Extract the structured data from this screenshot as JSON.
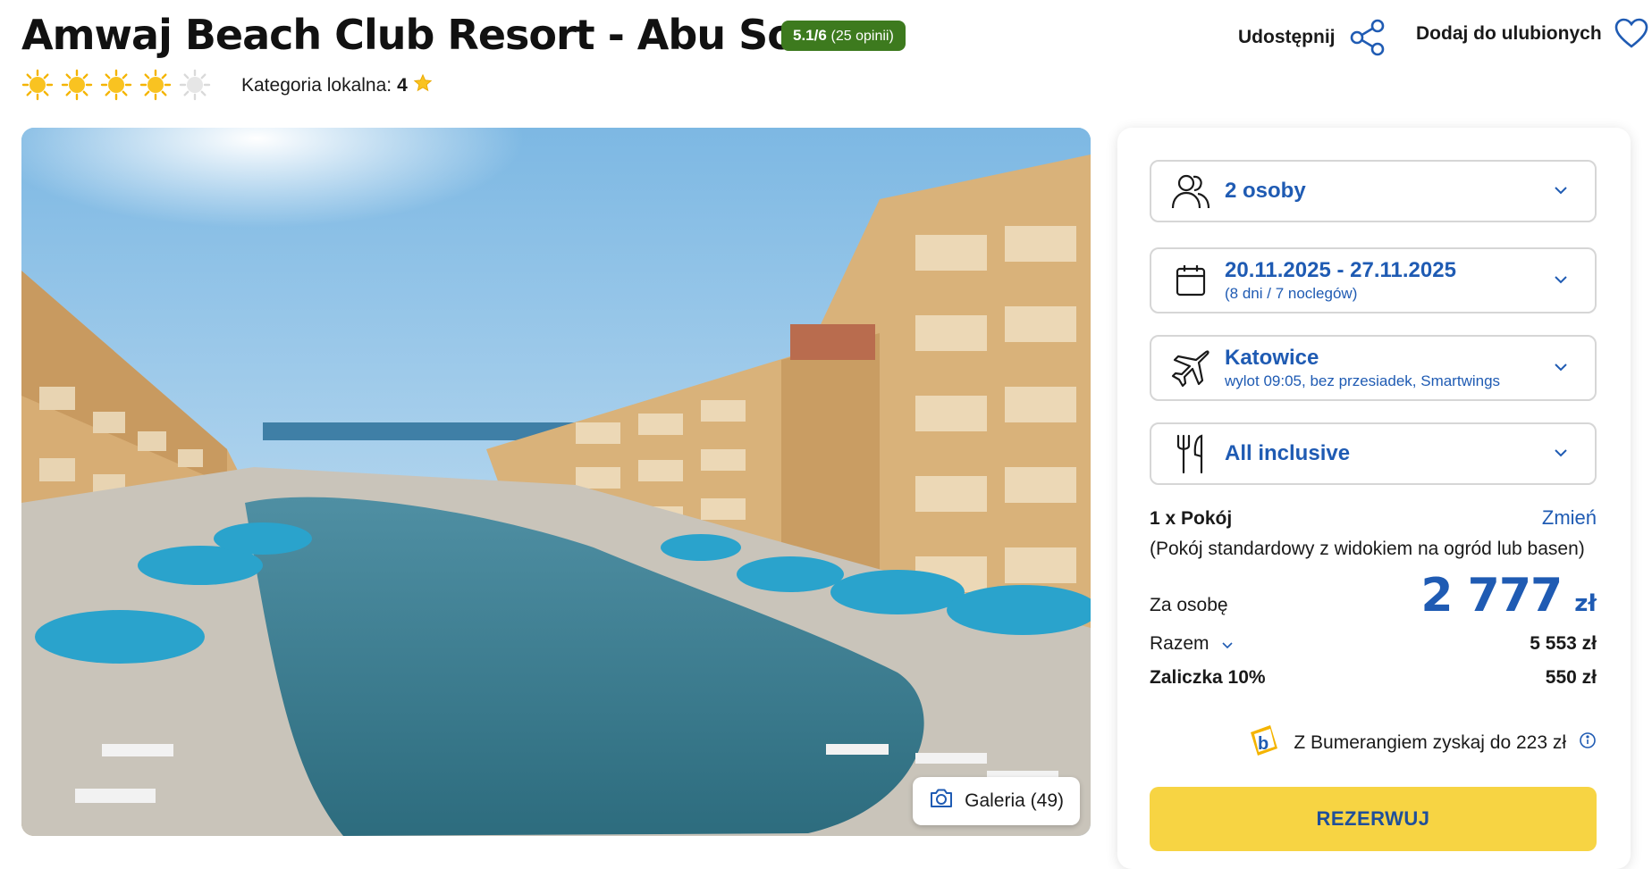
{
  "hotel": {
    "name": "Amwaj Beach Club Resort - Abu Soma",
    "rating_score": "5.1/6",
    "rating_opinions": "(25 opinii)",
    "stars_filled": 4,
    "stars_total": 5,
    "local_category_label": "Kategoria lokalna:",
    "local_category_value": "4"
  },
  "header_actions": {
    "share_label": "Udostępnij",
    "favorite_label": "Dodaj do ulubionych"
  },
  "gallery": {
    "button_label": "Galeria (49)"
  },
  "booking": {
    "guests": "2 osoby",
    "dates": "20.11.2025 - 27.11.2025",
    "dates_sub": "(8 dni / 7 noclegów)",
    "departure_city": "Katowice",
    "flight_info": "wylot 09:05, bez przesiadek, Smartwings",
    "board": "All inclusive",
    "room_count_label": "1 x Pokój",
    "change_link": "Zmień",
    "room_description": "(Pokój standardowy z widokiem na ogród lub basen)",
    "per_person_label": "Za osobę",
    "per_person_price": "2 777",
    "currency": "zł",
    "total_label": "Razem",
    "total_value": "5 553 zł",
    "deposit_label": "Zaliczka 10%",
    "deposit_value": "550 zł",
    "bumerang_text": "Z Bumerangiem zyskaj do 223 zł",
    "reserve_button": "REZERWUJ"
  },
  "colors": {
    "accent_blue": "#1f5bb3",
    "rating_green": "#3d7a1e",
    "reserve_yellow": "#f7d443",
    "sun_gold": "#f4b400"
  }
}
